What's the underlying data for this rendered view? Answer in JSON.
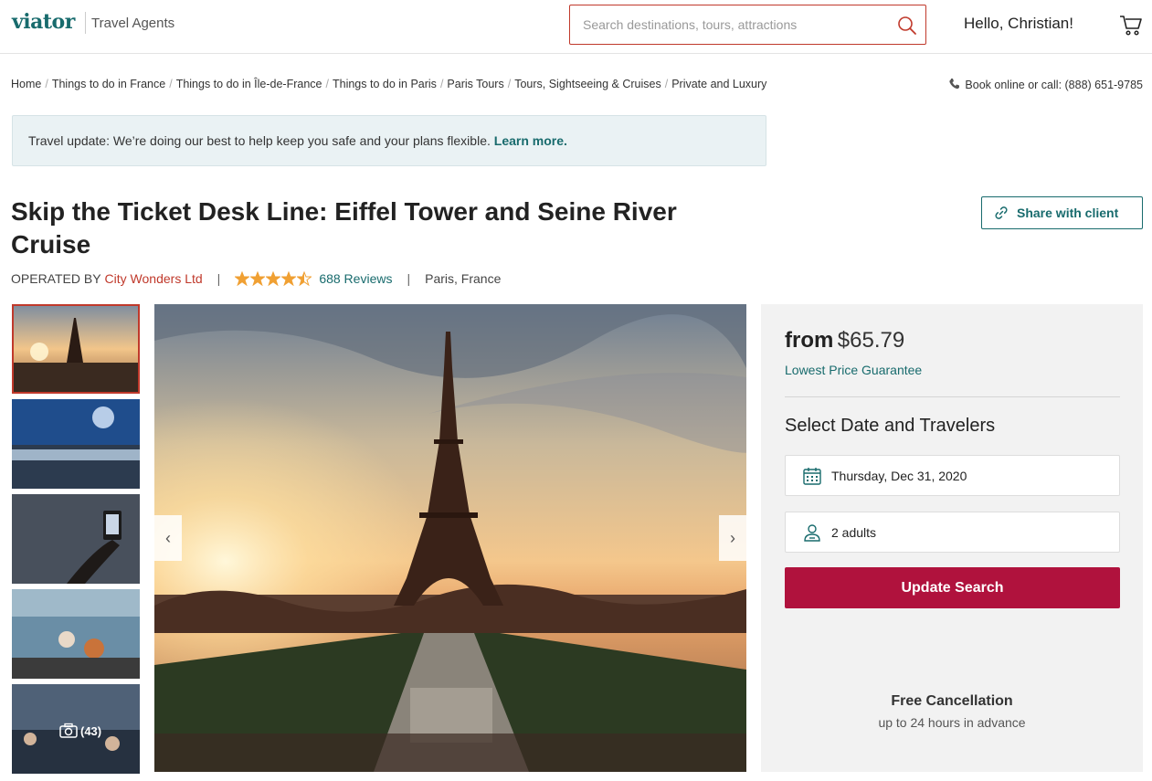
{
  "header": {
    "logo": "viator",
    "logo_sub": "Travel Agents",
    "search_placeholder": "Search destinations, tours, attractions",
    "greeting": "Hello, Christian!"
  },
  "breadcrumb": [
    "Home",
    "Things to do in France",
    "Things to do in Île-de-France",
    "Things to do in Paris",
    "Paris Tours",
    "Tours, Sightseeing & Cruises",
    "Private and Luxury"
  ],
  "phone": "Book online or call: (888) 651-9785",
  "banner": {
    "text": "Travel update: We’re doing our best to help keep you safe and your plans flexible.",
    "link": "Learn more."
  },
  "product": {
    "title": "Skip the Ticket Desk Line: Eiffel Tower and Seine River Cruise",
    "operated_by_label": "OPERATED BY",
    "operator": "City Wonders Ltd",
    "rating": 4.5,
    "reviews": "688 Reviews",
    "location": "Paris, France",
    "share_label": "Share with client"
  },
  "gallery": {
    "photo_count": "(43)",
    "prev_label": "‹",
    "next_label": "›"
  },
  "booking": {
    "from_label": "from",
    "price": "$65.79",
    "guarantee": "Lowest Price Guarantee",
    "select_title": "Select Date and Travelers",
    "date": "Thursday, Dec 31, 2020",
    "travelers": "2 adults",
    "update_label": "Update Search",
    "free_title": "Free Cancellation",
    "free_sub": "up to 24 hours in advance"
  },
  "colors": {
    "brand_teal": "#186b6d",
    "accent_red": "#c0392b",
    "cta": "#b0123d",
    "star": "#f0a033"
  }
}
